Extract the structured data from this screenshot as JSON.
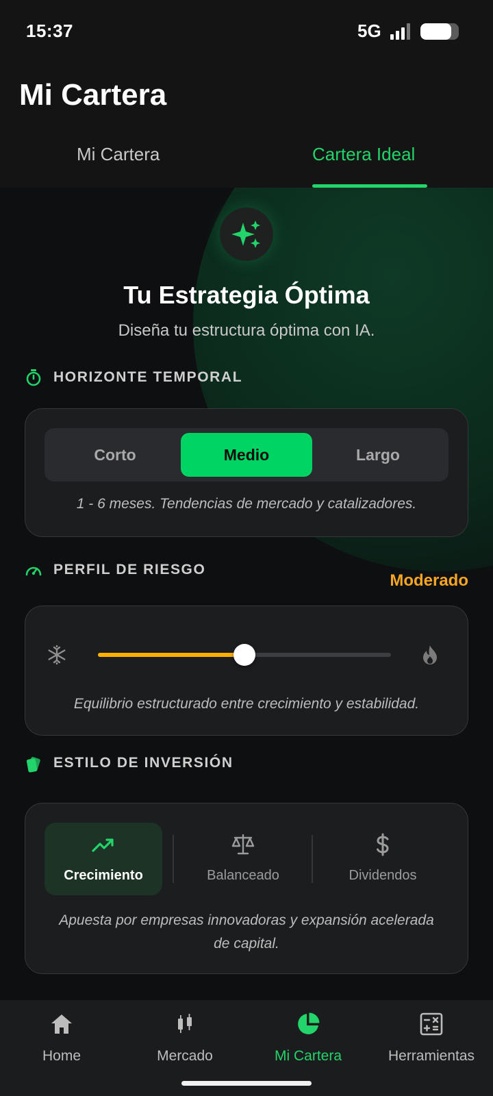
{
  "status": {
    "time": "15:37",
    "network": "5G",
    "battery_level": 0.8
  },
  "header": {
    "title": "Mi Cartera",
    "tabs": [
      {
        "label": "Mi Cartera",
        "active": false
      },
      {
        "label": "Cartera Ideal",
        "active": true
      }
    ]
  },
  "hero": {
    "icon": "sparkles-icon",
    "title": "Tu Estrategia Óptima",
    "subtitle": "Diseña tu estructura óptima con IA."
  },
  "horizon": {
    "label": "HORIZONTE TEMPORAL",
    "icon": "stopwatch-icon",
    "options": [
      "Corto",
      "Medio",
      "Largo"
    ],
    "selected": "Medio",
    "note": "1 - 6 meses. Tendencias de mercado y catalizadores."
  },
  "risk": {
    "label": "PERFIL DE RIESGO",
    "icon": "gauge-icon",
    "value_label": "Moderado",
    "level": 0.5,
    "min_icon": "snowflake-icon",
    "max_icon": "flame-icon",
    "note": "Equilibrio estructurado entre crecimiento y estabilidad."
  },
  "style": {
    "label": "ESTILO DE INVERSIÓN",
    "icon": "cards-icon",
    "options": [
      {
        "label": "Crecimiento",
        "icon": "trending-up-icon",
        "active": true
      },
      {
        "label": "Balanceado",
        "icon": "scale-icon",
        "active": false
      },
      {
        "label": "Dividendos",
        "icon": "dollar-icon",
        "active": false
      }
    ],
    "note_line1": "Apuesta por empresas innovadoras y expansión acelerada",
    "note_line2": "de capital."
  },
  "nav": [
    {
      "label": "Home",
      "icon": "home-icon",
      "active": false
    },
    {
      "label": "Mercado",
      "icon": "candlestick-icon",
      "active": false
    },
    {
      "label": "Mi Cartera",
      "icon": "pie-chart-icon",
      "active": true
    },
    {
      "label": "Herramientas",
      "icon": "calculator-icon",
      "active": false
    }
  ],
  "colors": {
    "accent": "#22d46a",
    "risk": "#f5a623",
    "slider": "#ffb000"
  }
}
